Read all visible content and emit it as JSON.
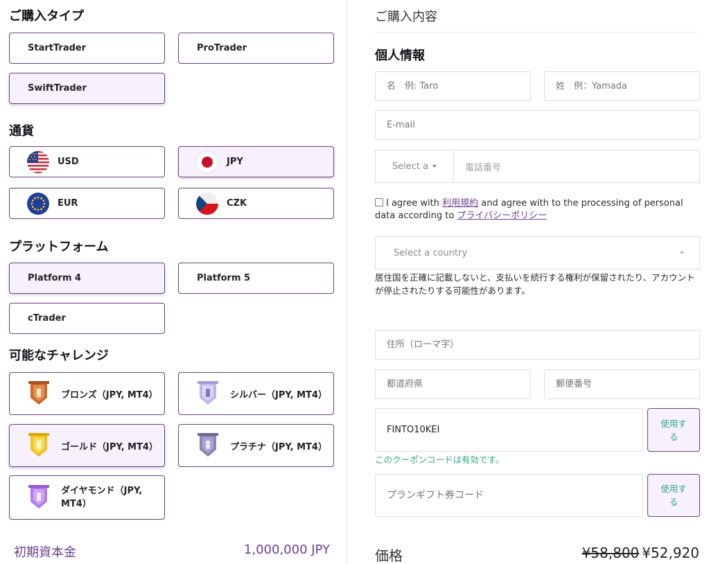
{
  "purchase_type": {
    "title": "ご購入タイプ",
    "options": [
      "StartTrader",
      "ProTrader",
      "SwiftTrader"
    ],
    "selected": "SwiftTrader"
  },
  "currency": {
    "title": "通貨",
    "options": [
      "USD",
      "JPY",
      "EUR",
      "CZK"
    ],
    "flag_icons": [
      "usa-flag-icon",
      "japan-flag-icon",
      "eu-flag-icon",
      "czech-flag-icon"
    ],
    "selected": "JPY"
  },
  "platform": {
    "title": "プラットフォーム",
    "options": [
      "Platform 4",
      "Platform 5",
      "cTrader"
    ],
    "selected": "Platform 4"
  },
  "challenge": {
    "title": "可能なチャレンジ",
    "options": [
      "ブロンズ（JPY, MT4）",
      "シルバー（JPY, MT4）",
      "ゴールド（JPY, MT4）",
      "プラチナ（JPY, MT4）",
      "ダイヤモンド（JPY, MT4）"
    ],
    "badge_icons": [
      "bronze-badge-icon",
      "silver-badge-icon",
      "gold-badge-icon",
      "platinum-badge-icon",
      "diamond-badge-icon"
    ],
    "badge_colors": [
      "#c8692b",
      "#b9b8e8",
      "#f2c21b",
      "#8a84b4",
      "#b37be8"
    ],
    "selected": "ゴールド（JPY, MT4）"
  },
  "capital": {
    "label": "初期資本金",
    "value": "1,000,000 JPY"
  },
  "summary": {
    "title": "ご購入内容"
  },
  "personal": {
    "title": "個人情報",
    "first_name_placeholder": "名　例: Taro",
    "last_name_placeholder": "姓　例：Yamada",
    "email_placeholder": "E-mail",
    "country_code_select": "Select a",
    "phone_placeholder": "電話番号",
    "agree_prefix": "I agree with ",
    "terms_link": "利用規約",
    "agree_middle": " and agree with to the processing of personal data according to ",
    "privacy_link": "プライバシーポリシー",
    "country_select": "Select a country",
    "country_note": "居住国を正確に記載しないと、支払いを続行する権利が保留されたり、アカウントが停止されたりする可能性があります。",
    "address_placeholder": "住所（ローマ字）",
    "prefecture_placeholder": "都道府県",
    "postal_placeholder": "郵便番号"
  },
  "coupon": {
    "value": "FINTO10KEI",
    "apply_label": "使用する",
    "valid_message": "このクーポンコードは有効です。",
    "gift_placeholder": "プランギフト券コード",
    "gift_apply_label": "使用する"
  },
  "price": {
    "label": "価格",
    "old": "¥58,800",
    "new": "¥52,920"
  },
  "colors": {
    "accent": "#6b3f8e",
    "selected_bg": "#f7f1fd",
    "success": "#2eaa7d"
  }
}
